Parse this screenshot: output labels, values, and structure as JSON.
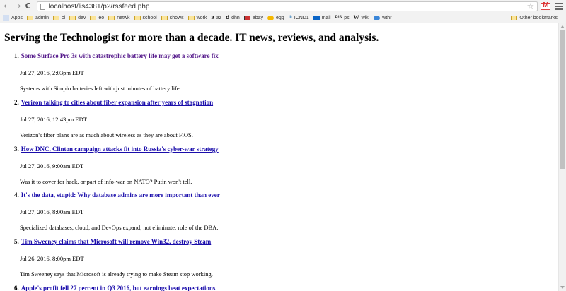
{
  "browser": {
    "url": "localhost/lis4381/p2/rssfeed.php",
    "bookmarks": [
      {
        "label": "Apps",
        "icon": "apps-icon"
      },
      {
        "label": "admin",
        "icon": "folder-icon"
      },
      {
        "label": "cl",
        "icon": "folder-icon"
      },
      {
        "label": "dev",
        "icon": "folder-icon"
      },
      {
        "label": "eo",
        "icon": "folder-icon"
      },
      {
        "label": "netwk",
        "icon": "folder-icon"
      },
      {
        "label": "school",
        "icon": "folder-icon"
      },
      {
        "label": "shows",
        "icon": "folder-icon"
      },
      {
        "label": "work",
        "icon": "folder-icon"
      },
      {
        "label": "az",
        "icon": "amazon-icon"
      },
      {
        "label": "dhn",
        "icon": "d-icon"
      },
      {
        "label": "ebay",
        "icon": "ebay-icon"
      },
      {
        "label": "egg",
        "icon": "egg-icon"
      },
      {
        "label": "ICND1",
        "icon": "cisco-icon"
      },
      {
        "label": "mail",
        "icon": "outlook-icon"
      },
      {
        "label": "ps",
        "icon": "ps-icon"
      },
      {
        "label": "wiki",
        "icon": "wikipedia-icon"
      },
      {
        "label": "wthr",
        "icon": "weather-icon"
      }
    ],
    "other_bookmarks": "Other bookmarks"
  },
  "page": {
    "title": "Serving the Technologist for more than a decade. IT news, reviews, and analysis.",
    "items": [
      {
        "num": "1.",
        "title": "Some Surface Pro 3s with catastrophic battery life may get a software fix",
        "date": "Jul 27, 2016, 2:03pm EDT",
        "desc": "Systems with Simplo batteries left with just minutes of battery life."
      },
      {
        "num": "2.",
        "title": "Verizon talking to cities about fiber expansion after years of stagnation",
        "date": "Jul 27, 2016, 12:43pm EDT",
        "desc": "Verizon's fiber plans are as much about wireless as they are about FiOS."
      },
      {
        "num": "3.",
        "title": "How DNC, Clinton campaign attacks fit into Russia's cyber-war strategy",
        "date": "Jul 27, 2016, 9:00am EDT",
        "desc": "Was it to cover for hack, or part of info-war on NATO? Putin won't tell."
      },
      {
        "num": "4.",
        "title": "It's the data, stupid: Why database admins are more important than ever",
        "date": "Jul 27, 2016, 8:00am EDT",
        "desc": "Specialized databases, cloud, and DevOps expand, not eliminate, role of the DBA."
      },
      {
        "num": "5.",
        "title": "Tim Sweeney claims that Microsoft will remove Win32, destroy Steam",
        "date": "Jul 26, 2016, 8:00pm EDT",
        "desc": "Tim Sweeney says that Microsoft is already trying to make Steam stop working."
      },
      {
        "num": "6.",
        "title": "Apple's profit fell 27 percent in Q3 2016, but earnings beat expectations",
        "date": "",
        "desc": ""
      }
    ]
  }
}
